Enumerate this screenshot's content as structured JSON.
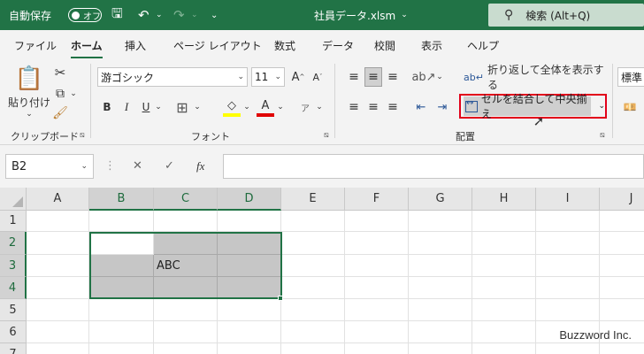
{
  "titlebar": {
    "autosave_label": "自動保存",
    "autosave_state": "オフ",
    "filename": "社員データ.xlsm",
    "filename_caret": "⌄",
    "search_placeholder": "検索 (Alt+Q)"
  },
  "tabs": [
    "ファイル",
    "ホーム",
    "挿入",
    "ページ レイアウト",
    "数式",
    "データ",
    "校閲",
    "表示",
    "ヘルプ"
  ],
  "active_tab": "ホーム",
  "ribbon": {
    "clipboard": {
      "paste_label": "貼り付け",
      "group_label": "クリップボード"
    },
    "font": {
      "font_name": "游ゴシック",
      "font_size": "11",
      "bold": "B",
      "italic": "I",
      "underline": "U",
      "group_label": "フォント"
    },
    "alignment": {
      "wrap_text": "折り返して全体を表示する",
      "merge_center": "セルを結合して中央揃え",
      "group_label": "配置"
    },
    "number": {
      "format": "標準"
    }
  },
  "formula_bar": {
    "name_box": "B2",
    "fx": "fx",
    "content": ""
  },
  "columns": [
    "A",
    "B",
    "C",
    "D",
    "E",
    "F",
    "G",
    "H",
    "I",
    "J"
  ],
  "rows": [
    "1",
    "2",
    "3",
    "4",
    "5",
    "6",
    "7"
  ],
  "cells": {
    "B3": "",
    "C3": "ABC"
  },
  "selection": "B2:D4",
  "watermark": "Buzzword Inc."
}
